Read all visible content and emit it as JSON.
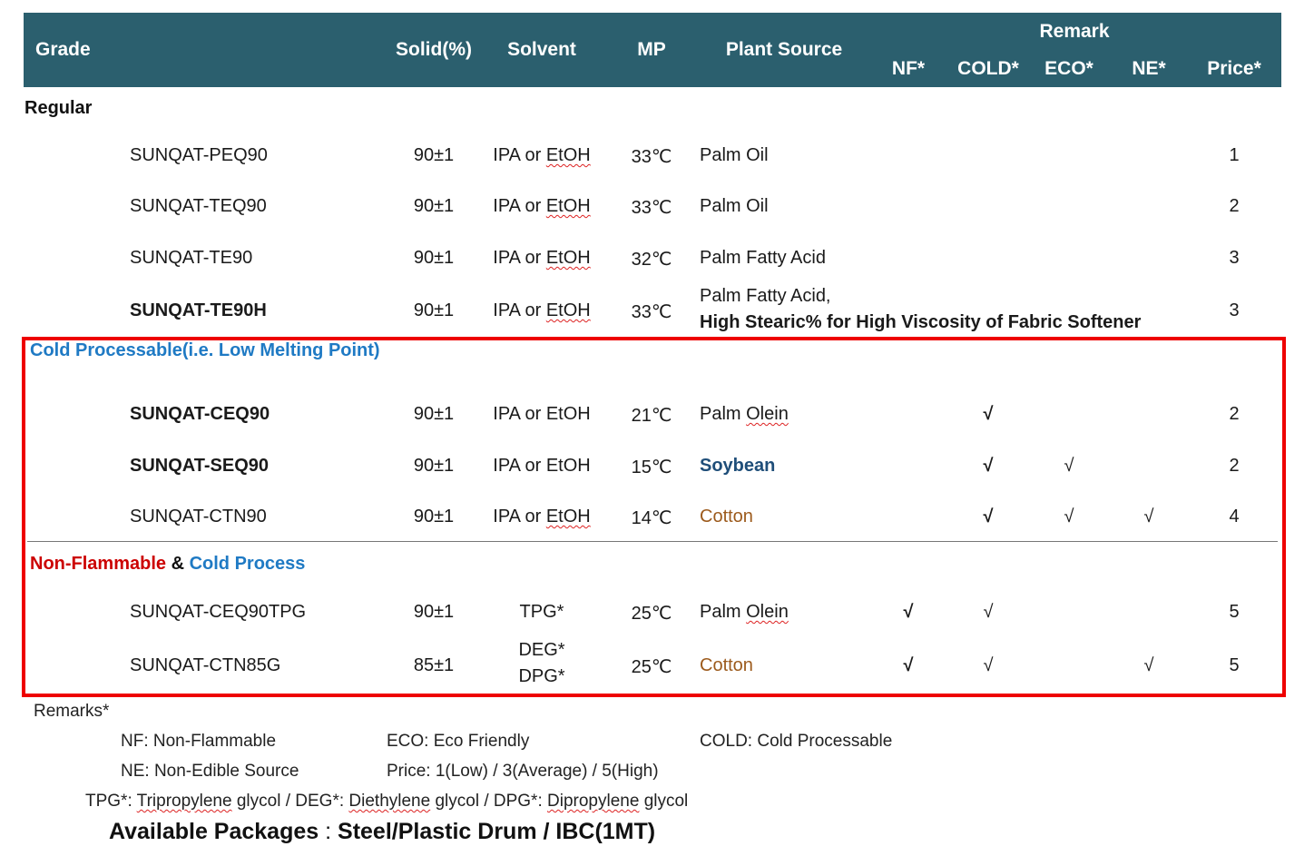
{
  "header": {
    "grade": "Grade",
    "solid": "Solid(%)",
    "solvent": "Solvent",
    "mp": "MP",
    "plant_source": "Plant Source",
    "remark": "Remark",
    "nf": "NF*",
    "cold": "COLD*",
    "eco": "ECO*",
    "ne": "NE*",
    "price": "Price*"
  },
  "sections": {
    "regular": "Regular",
    "cold_processable": "Cold Processable(i.e. Low Melting Point)",
    "non_flammable": "Non-Flammable",
    "amp": " & ",
    "cold_process": "Cold Process"
  },
  "rows": [
    {
      "grade": "SUNQAT-PEQ90",
      "solid": "90±1",
      "solvent_a": "IPA or ",
      "solvent_b": "EtOH",
      "mp": "33℃",
      "source": "Palm Oil",
      "nf": "",
      "cold": "",
      "eco": "",
      "ne": "",
      "price": "1"
    },
    {
      "grade": "SUNQAT-TEQ90",
      "solid": "90±1",
      "solvent_a": "IPA or ",
      "solvent_b": "EtOH",
      "mp": "33℃",
      "source": "Palm Oil",
      "nf": "",
      "cold": "",
      "eco": "",
      "ne": "",
      "price": "2"
    },
    {
      "grade": "SUNQAT-TE90",
      "solid": "90±1",
      "solvent_a": "IPA or ",
      "solvent_b": "EtOH",
      "mp": "32℃",
      "source": "Palm Fatty Acid",
      "nf": "",
      "cold": "",
      "eco": "",
      "ne": "",
      "price": "3"
    },
    {
      "grade": "SUNQAT-TE90H",
      "solid": "90±1",
      "solvent_a": "IPA or ",
      "solvent_b": "EtOH",
      "mp": "33℃",
      "source": "Palm Fatty Acid,",
      "source_line2": "High Stearic% for High Viscosity of Fabric Softener",
      "nf": "",
      "cold": "",
      "eco": "",
      "ne": "",
      "price": "3"
    },
    {
      "grade": "SUNQAT-CEQ90",
      "solid": "90±1",
      "solvent": "IPA or EtOH",
      "mp": "21℃",
      "source_a": "Palm ",
      "source_b": "Olein",
      "nf": "",
      "cold": "√",
      "eco": "",
      "ne": "",
      "price": "2"
    },
    {
      "grade": "SUNQAT-SEQ90",
      "solid": "90±1",
      "solvent": "IPA or EtOH",
      "mp": "15℃",
      "source": "Soybean",
      "nf": "",
      "cold": "√",
      "eco": "√",
      "ne": "",
      "price": "2"
    },
    {
      "grade": "SUNQAT-CTN90",
      "solid": "90±1",
      "solvent_a": "IPA or ",
      "solvent_b": "EtOH",
      "mp": "14℃",
      "source": "Cotton",
      "nf": "",
      "cold": "√",
      "eco": "√",
      "ne": "√",
      "price": "4"
    },
    {
      "grade": "SUNQAT-CEQ90TPG",
      "solid": "90±1",
      "solvent": "TPG*",
      "mp": "25℃",
      "source_a": "Palm ",
      "source_b": "Olein",
      "nf": "√",
      "cold": "√",
      "eco": "",
      "ne": "",
      "price": "5"
    },
    {
      "grade": "SUNQAT-CTN85G",
      "solid": "85±1",
      "solvent": "DEG*",
      "solvent_line2": "DPG*",
      "mp": "25℃",
      "source": "Cotton",
      "nf": "√",
      "cold": "√",
      "eco": "",
      "ne": "√",
      "price": "5"
    }
  ],
  "remarks": {
    "title": "Remarks*",
    "nf": "NF: Non-Flammable",
    "eco": "ECO: Eco Friendly",
    "cold": "COLD: Cold Processable",
    "ne": "NE: Non-Edible Source",
    "price": "Price: 1(Low) / 3(Average) / 5(High)",
    "glycol_a": "TPG*: ",
    "glycol_b": "Tripropylene",
    "glycol_c": " glycol / DEG*: ",
    "glycol_d": "Diethylene",
    "glycol_e": " glycol / DPG*: ",
    "glycol_f": "Dipropylene",
    "glycol_g": " glycol"
  },
  "packages": {
    "label": "Available Packages",
    "sep": " : ",
    "value": "Steel/Plastic Drum / IBC(1MT)"
  },
  "colors": {
    "header_bg": "#2b5f6e",
    "section_blue": "#1f7ac4",
    "section_red": "#cc0000",
    "soybean": "#1f4e79",
    "cotton": "#9c5a1c",
    "box_red": "#ee0000"
  }
}
